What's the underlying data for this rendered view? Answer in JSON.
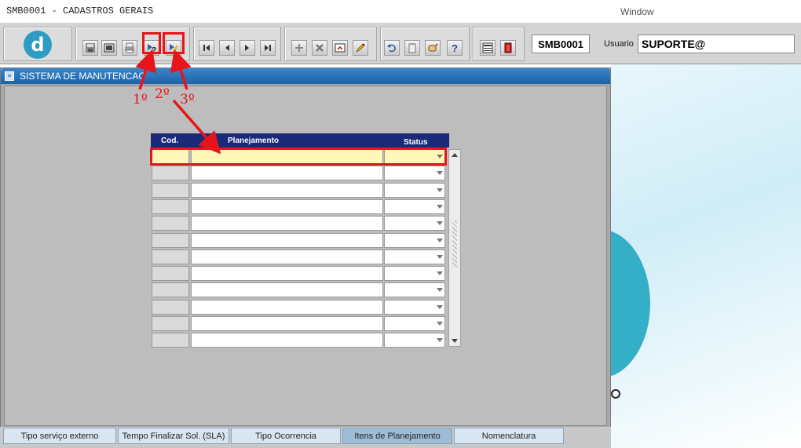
{
  "title_bar": {
    "app_title": "SMB0001 - CADASTROS GERAIS",
    "window_menu": "Window"
  },
  "toolbar": {
    "logo_letter": "d",
    "form_code": "SMB0001",
    "user_label": "Usuario",
    "user_value": "SUPORTE@"
  },
  "window": {
    "title": "SISTEMA DE MANUTENCAO"
  },
  "grid": {
    "columns": [
      "Cod.",
      "Planejamento",
      "Status"
    ],
    "row_count": 12
  },
  "annotations": [
    "1º",
    "2º",
    "3º"
  ],
  "tabs": [
    {
      "label": "Tipo serviço externo",
      "active": false
    },
    {
      "label": "Tempo Finalizar Sol. (SLA)",
      "active": false
    },
    {
      "label": "Tipo Ocorrencia",
      "active": false
    },
    {
      "label": "Itens de Planejamento",
      "active": true
    },
    {
      "label": "Nomenclatura",
      "active": false
    }
  ],
  "colors": {
    "accent": "#1b63a8",
    "grid_header": "#1a2a78",
    "highlight": "#e8141b",
    "active_row": "#fff6b8"
  }
}
